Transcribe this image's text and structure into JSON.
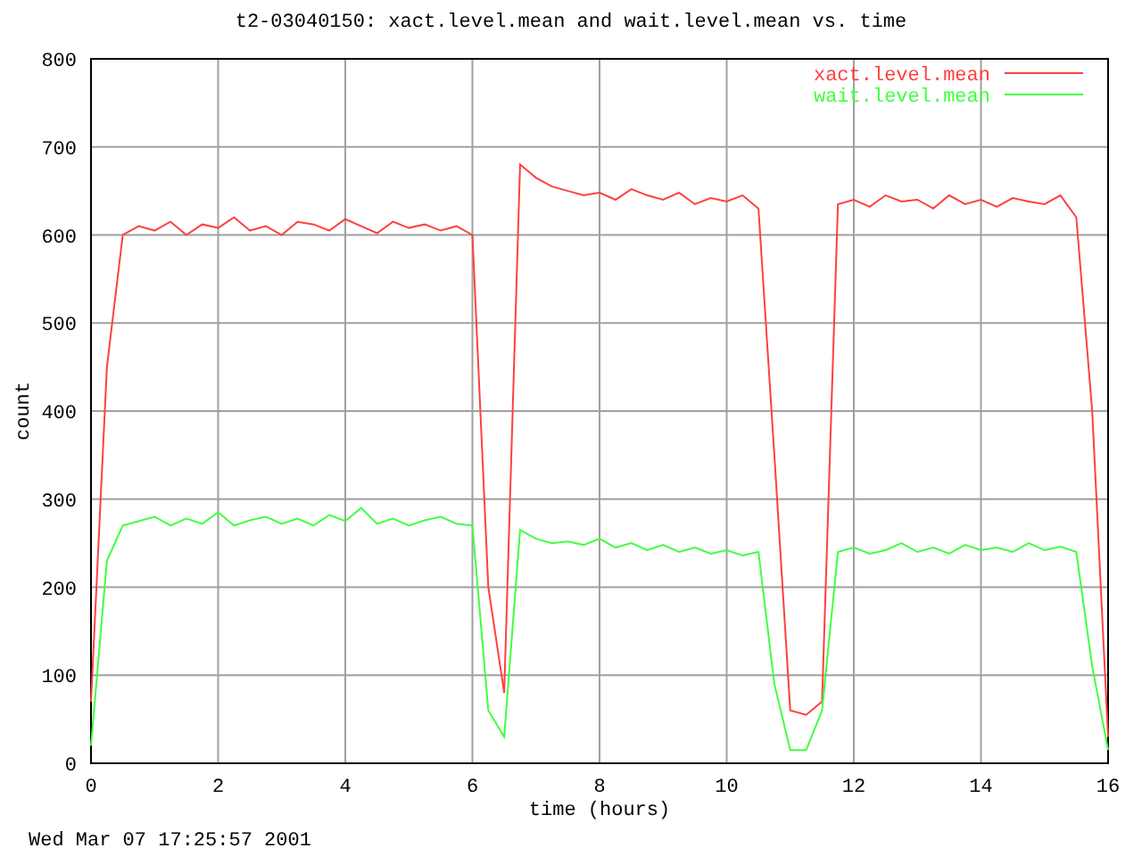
{
  "chart_data": {
    "type": "line",
    "title": "t2-03040150: xact.level.mean and wait.level.mean vs. time",
    "xlabel": "time (hours)",
    "ylabel": "count",
    "xlim": [
      0,
      16
    ],
    "ylim": [
      0,
      800
    ],
    "xticks": [
      0,
      2,
      4,
      6,
      8,
      10,
      12,
      14,
      16
    ],
    "yticks": [
      0,
      100,
      200,
      300,
      400,
      500,
      600,
      700,
      800
    ],
    "grid": true,
    "legend": true,
    "x": [
      0,
      0.25,
      0.5,
      0.75,
      1,
      1.25,
      1.5,
      1.75,
      2,
      2.25,
      2.5,
      2.75,
      3,
      3.25,
      3.5,
      3.75,
      4,
      4.25,
      4.5,
      4.75,
      5,
      5.25,
      5.5,
      5.75,
      6,
      6.25,
      6.5,
      6.75,
      7,
      7.25,
      7.5,
      7.75,
      8,
      8.25,
      8.5,
      8.75,
      9,
      9.25,
      9.5,
      9.75,
      10,
      10.25,
      10.5,
      10.75,
      11,
      11.25,
      11.5,
      11.75,
      12,
      12.25,
      12.5,
      12.75,
      13,
      13.25,
      13.5,
      13.75,
      14,
      14.25,
      14.5,
      14.75,
      15,
      15.25,
      15.5,
      15.75,
      16
    ],
    "series": [
      {
        "name": "xact.level.mean",
        "color": "#ff4040",
        "values": [
          70,
          450,
          600,
          610,
          605,
          615,
          600,
          612,
          608,
          620,
          605,
          610,
          600,
          615,
          612,
          605,
          618,
          610,
          602,
          615,
          608,
          612,
          605,
          610,
          600,
          200,
          80,
          680,
          665,
          655,
          650,
          645,
          648,
          640,
          652,
          645,
          640,
          648,
          635,
          642,
          638,
          645,
          630,
          350,
          60,
          55,
          70,
          635,
          640,
          632,
          645,
          638,
          640,
          630,
          645,
          635,
          640,
          632,
          642,
          638,
          635,
          645,
          620,
          400,
          30
        ]
      },
      {
        "name": "wait.level.mean",
        "color": "#40ff40",
        "values": [
          20,
          230,
          270,
          275,
          280,
          270,
          278,
          272,
          285,
          270,
          276,
          280,
          272,
          278,
          270,
          282,
          275,
          290,
          272,
          278,
          270,
          276,
          280,
          272,
          270,
          60,
          30,
          265,
          255,
          250,
          252,
          248,
          255,
          245,
          250,
          242,
          248,
          240,
          245,
          238,
          242,
          236,
          240,
          90,
          15,
          15,
          60,
          240,
          245,
          238,
          242,
          250,
          240,
          245,
          238,
          248,
          242,
          245,
          240,
          250,
          242,
          246,
          240,
          110,
          15
        ]
      }
    ]
  },
  "timestamp": "Wed Mar 07 17:25:57 2001"
}
